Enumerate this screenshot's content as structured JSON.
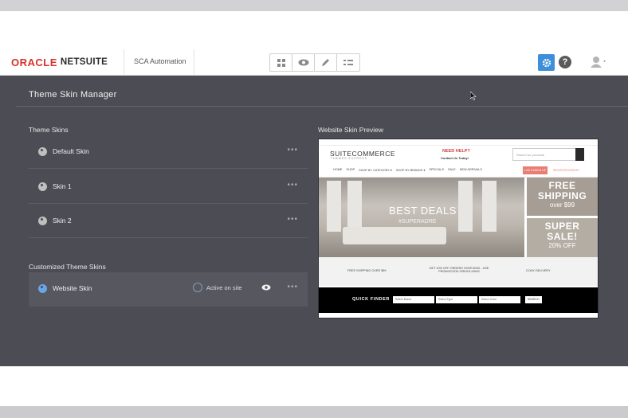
{
  "header": {
    "logo_oracle": "ORACLE",
    "logo_netsuite": "NETSUITE",
    "account_name": "SCA Automation",
    "tools": [
      "grid-icon",
      "eye-icon",
      "pencil-icon",
      "checklist-icon"
    ],
    "settings_icon": "gear-icon",
    "help_label": "?",
    "user_icon": "user-icon"
  },
  "main": {
    "title": "Theme Skin Manager",
    "theme_skins_heading": "Theme Skins",
    "theme_skins": [
      {
        "name": "Default Skin",
        "menu": "•••"
      },
      {
        "name": "Skin 1",
        "menu": "•••"
      },
      {
        "name": "Skin 2",
        "menu": "•••"
      }
    ],
    "customized_heading": "Customized Theme Skins",
    "customized_skins": [
      {
        "name": "Website Skin",
        "status": "Active on site",
        "menu": "•••"
      }
    ]
  },
  "preview": {
    "heading": "Website Skin Preview",
    "site_logo": "SUITECOMMERCE",
    "site_logo_sub": "THEMES EXPRESS",
    "need_help": "NEED HELP?",
    "contact": "Contact Us Today!",
    "search_placeholder": "Search for products",
    "nav_items": [
      "HOME",
      "SHOP",
      "SHOP BY CATEGORY ▾",
      "SHOP BY BRANDS ▾",
      "SPECIALS",
      "SALE",
      "NEW ARRIVALS"
    ],
    "login": "LOG IN/SIGN UP",
    "register": "REGISTER/CREATE",
    "hero_title": "BEST DEALS",
    "hero_sub": "#SUPERADRE",
    "ship_line1": "FREE",
    "ship_line2": "SHIPPING",
    "ship_line3": "over $99",
    "sale_line1": "SUPER",
    "sale_line2": "SALE!",
    "sale_line3": "20% OFF",
    "promo1": "FREE SHIPPING OVER $99",
    "promo2": "GET 10% OFF ORDERS OVER $100 - USE PROMOCODE GREATLIVING",
    "promo3": "2-DAY DELIVERY",
    "finder_label": "QUICK FINDER",
    "finder_brand": "Select Brand",
    "finder_type": "Select Type",
    "finder_color": "Select Color",
    "finder_button": "SEARCH"
  },
  "colors": {
    "brand_red": "#d7322b",
    "accent_blue": "#3d8fd9",
    "panel_bg": "#4c4c55"
  }
}
